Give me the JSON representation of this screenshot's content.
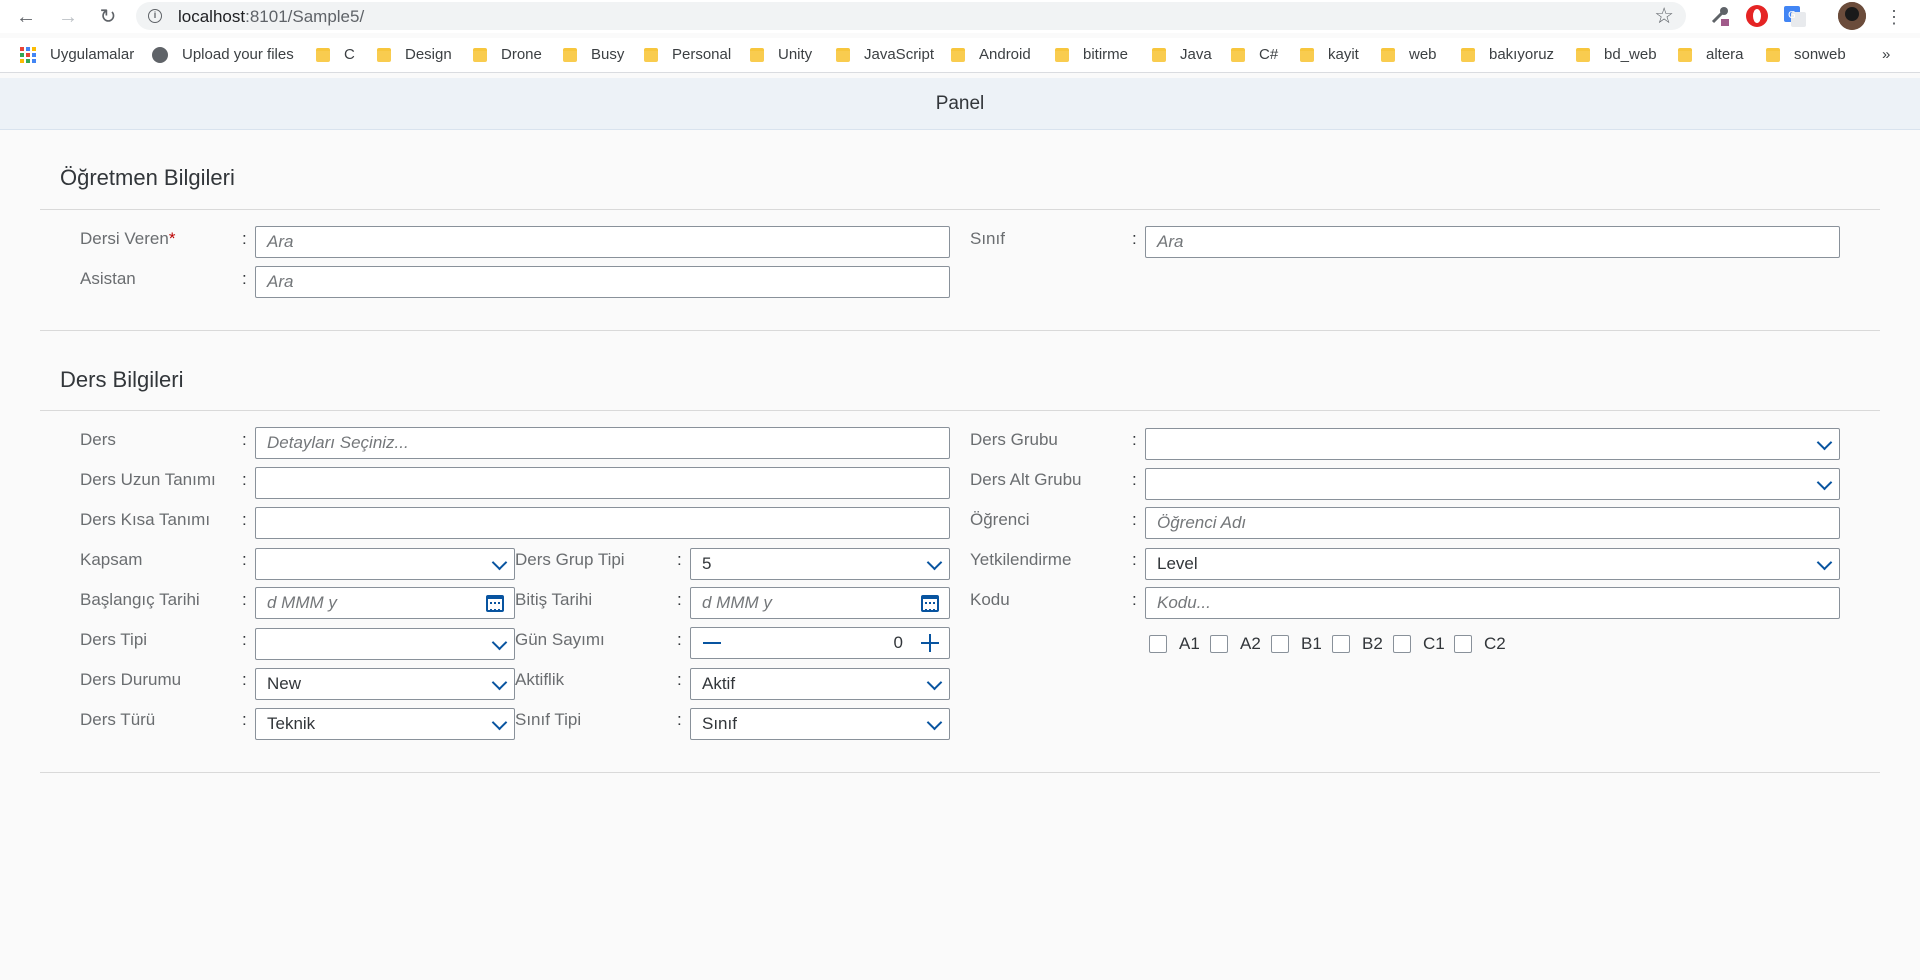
{
  "browser": {
    "url_host": "localhost",
    "url_path": ":8101/Sample5/",
    "bookmarks": [
      "Uygulamalar",
      "Upload your files",
      "C",
      "Design",
      "Drone",
      "Busy",
      "Personal",
      "Unity",
      "JavaScript",
      "Android",
      "bitirme",
      "Java",
      "C#",
      "kayit",
      "web",
      "bakıyoruz",
      "bd_web",
      "altera",
      "sonweb"
    ],
    "overflow": "»"
  },
  "panel": {
    "title": "Panel"
  },
  "teacher": {
    "title": "Öğretmen Bilgileri",
    "dersi_veren_label": "Dersi Veren",
    "required_mark": "*",
    "dersi_veren_placeholder": "Ara",
    "asistan_label": "Asistan",
    "asistan_placeholder": "Ara",
    "sinif_label": "Sınıf",
    "sinif_placeholder": "Ara"
  },
  "course": {
    "title": "Ders Bilgileri",
    "ders_label": "Ders",
    "ders_placeholder": "Detayları Seçiniz...",
    "uzun_label": "Ders Uzun Tanımı",
    "kisa_label": "Ders Kısa Tanımı",
    "kapsam_label": "Kapsam",
    "kapsam_value": "",
    "baslangic_label": "Başlangıç Tarihi",
    "baslangic_placeholder": "d MMM y",
    "tipi_label": "Ders Tipi",
    "tipi_value": "",
    "durumu_label": "Ders Durumu",
    "durumu_value": "New",
    "turu_label": "Ders Türü",
    "turu_value": "Teknik",
    "grup_tipi_label": "Ders Grup Tipi",
    "grup_tipi_value": "5",
    "bitis_label": "Bitiş Tarihi",
    "bitis_placeholder": "d MMM y",
    "gun_label": "Gün Sayımı",
    "gun_value": "0",
    "aktiflik_label": "Aktiflik",
    "aktiflik_value": "Aktif",
    "sinif_tipi_label": "Sınıf Tipi",
    "sinif_tipi_value": "Sınıf",
    "grubu_label": "Ders Grubu",
    "alt_grubu_label": "Ders Alt Grubu",
    "ogrenci_label": "Öğrenci",
    "ogrenci_placeholder": "Öğrenci Adı",
    "yetki_label": "Yetkilendirme",
    "yetki_value": "Level",
    "kodu_label": "Kodu",
    "kodu_placeholder": "Kodu...",
    "levels": [
      "A1",
      "A2",
      "B1",
      "B2",
      "C1",
      "C2"
    ]
  },
  "colon": ":"
}
